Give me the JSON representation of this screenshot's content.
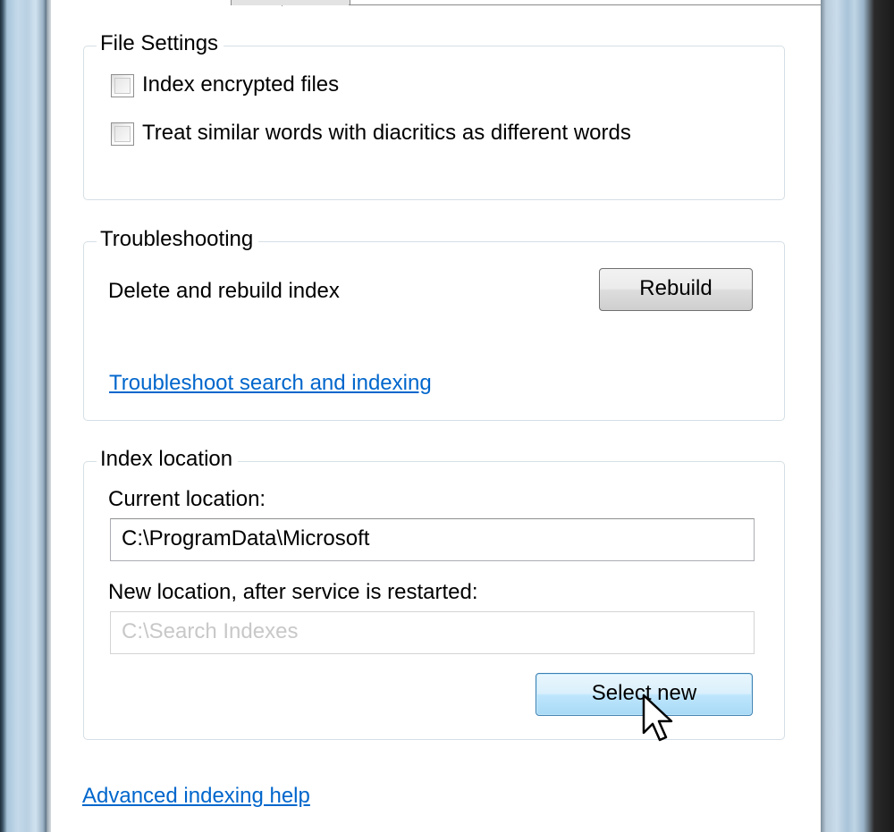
{
  "file_settings": {
    "legend": "File Settings",
    "index_encrypted_label": "Index encrypted files",
    "diacritics_label": "Treat similar words with diacritics as different words"
  },
  "troubleshooting": {
    "legend": "Troubleshooting",
    "delete_rebuild_label": "Delete and rebuild index",
    "rebuild_button": "Rebuild",
    "troubleshoot_link": "Troubleshoot search and indexing"
  },
  "index_location": {
    "legend": "Index location",
    "current_label": "Current location:",
    "current_value": "C:\\ProgramData\\Microsoft",
    "new_label": "New location, after service is restarted:",
    "new_value": "C:\\Search Indexes",
    "select_new_button": "Select new"
  },
  "footer": {
    "advanced_help_link": "Advanced indexing help"
  },
  "colors": {
    "link": "#0066cc",
    "hover_button_border": "#3c7fb1"
  }
}
